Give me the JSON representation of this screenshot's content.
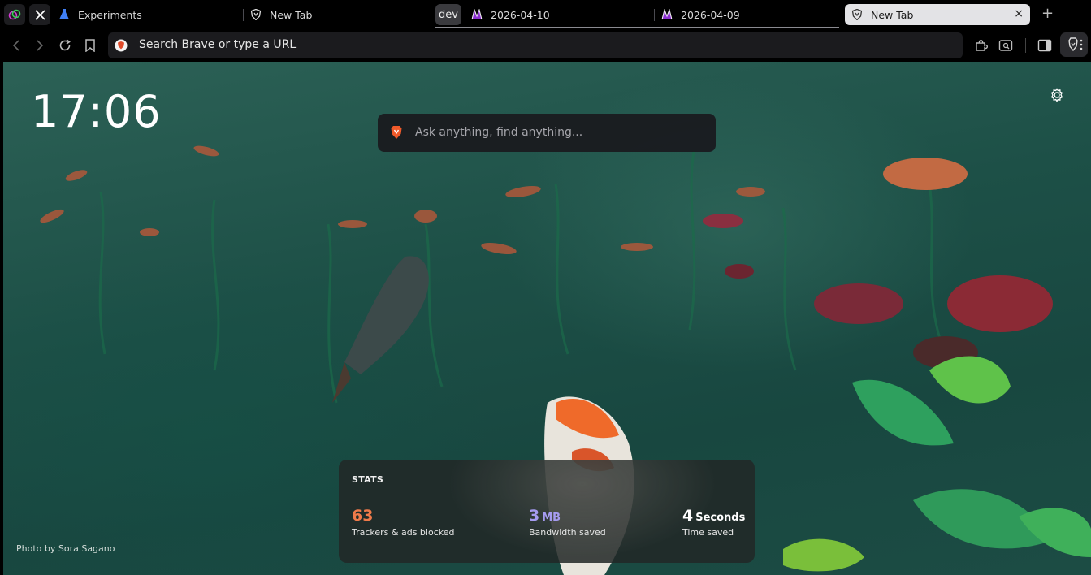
{
  "tabs": {
    "pinned": [
      {
        "name": "pinned-tab-app",
        "icon": "app-icon"
      },
      {
        "name": "pinned-tab-x",
        "icon": "x-logo-icon"
      }
    ],
    "items": [
      {
        "label": "Experiments",
        "icon": "flask-icon"
      },
      {
        "label": "New Tab",
        "icon": "brave-shield-icon"
      },
      {
        "label": "2026-04-10",
        "icon": "page-favicon-icon"
      },
      {
        "label": "2026-04-09",
        "icon": "page-favicon-icon"
      },
      {
        "label": "New Tab",
        "icon": "brave-shield-icon",
        "active": true
      }
    ],
    "group_label": "dev",
    "close_symbol": "×",
    "new_tab_symbol": "+"
  },
  "toolbar": {
    "address_placeholder": "Search Brave or type a URL"
  },
  "ntp": {
    "clock": "17:06",
    "search_placeholder": "Ask anything, find anything...",
    "photo_credit": "Photo by Sora Sagano",
    "stats": {
      "title": "STATS",
      "trackers_value": "63",
      "trackers_label": "Trackers & ads blocked",
      "bandwidth_value": "3",
      "bandwidth_unit": "MB",
      "bandwidth_label": "Bandwidth saved",
      "time_value": "4",
      "time_unit": "Seconds",
      "time_label": "Time saved"
    }
  },
  "colors": {
    "trackers": "#f07a4a",
    "bandwidth": "#a59bf0",
    "time": "#ffffff",
    "water": "#1d5047"
  }
}
